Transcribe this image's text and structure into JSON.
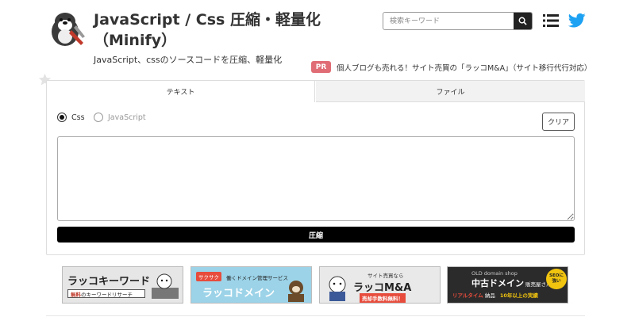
{
  "header": {
    "title": "JavaScript / Css 圧縮・軽量化（Minify）",
    "subtitle": "JavaScript、cssのソースコードを圧縮、軽量化",
    "search_placeholder": "検索キーワード"
  },
  "ad": {
    "badge": "PR",
    "text": "個人ブログも売れる！サイト売買の「ラッコM&A」（サイト移行代行対応）"
  },
  "tabs": [
    {
      "label": "テキスト",
      "active": true
    },
    {
      "label": "ファイル",
      "active": false
    }
  ],
  "form": {
    "radios": [
      {
        "label": "Css",
        "checked": true
      },
      {
        "label": "JavaScript",
        "checked": false
      }
    ],
    "clear_label": "クリア",
    "textarea_value": "",
    "submit_label": "圧縮"
  },
  "banners": [
    {
      "main": "ラッコキーワード",
      "tag": "無料",
      "sub": "のキーワードリサーチ"
    },
    {
      "badge": "サクサク",
      "top": "働くドメイン管理サービス",
      "main": "ラッコドメイン"
    },
    {
      "top": "サイト売買なら",
      "main": "ラッコM&A",
      "sub": "売却手数料無料！"
    },
    {
      "top": "OLD domain shop",
      "main": "中古ドメイン",
      "main_suffix": "販売屋さん",
      "sub1": "リアルタイム",
      "sub1_suffix": "納品",
      "sub2": "10年以上の実績",
      "seal": "SEOに強い"
    }
  ],
  "colors": {
    "accent": "#000000",
    "pr_badge": "#e06c75",
    "twitter": "#1da1f2",
    "banner_keyword": "#e6e6e6",
    "banner_domain": "#9cd3e8",
    "banner_ma": "#e9e9e9",
    "banner_old": "#2b2b2b"
  },
  "icons": {
    "logo": "otter-logo-icon",
    "search": "search-icon",
    "menu": "menu-icon",
    "social": "twitter-icon",
    "favorite": "star-icon"
  }
}
